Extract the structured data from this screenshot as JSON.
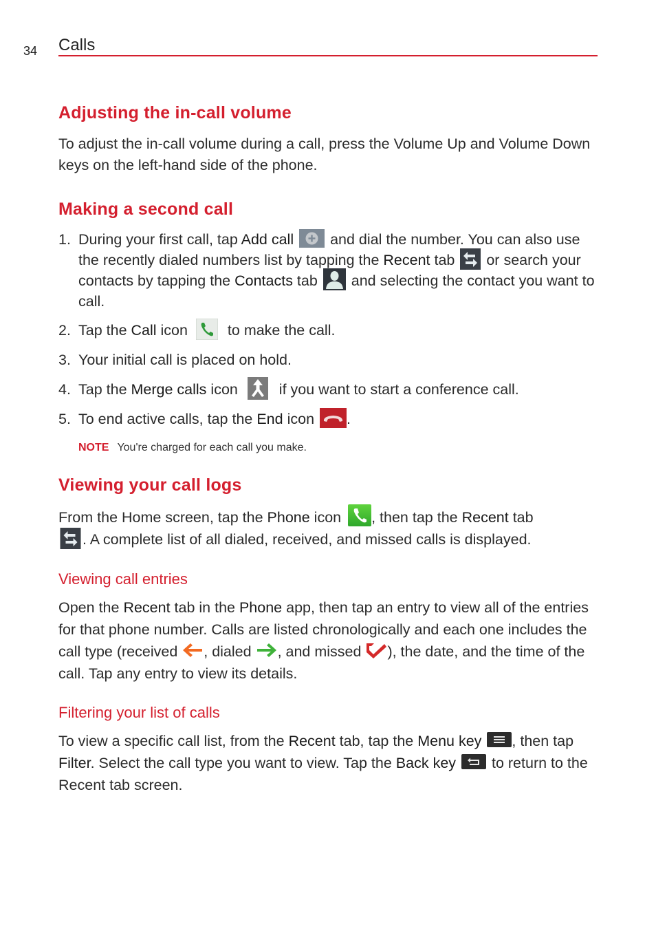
{
  "header": {
    "page_number": "34",
    "section": "Calls"
  },
  "colors": {
    "accent": "#d41f2e"
  },
  "sections": {
    "volume": {
      "title": "Adjusting the in-call volume",
      "body": "To adjust the in-call volume during a call, press the Volume Up and Volume Down keys on the left-hand side of the phone."
    },
    "second_call": {
      "title": "Making a second call",
      "steps": [
        {
          "num": "1.",
          "t1": "During your first call, tap ",
          "b1": "Add call",
          "t2": " and dial the number. You can also use the recently dialed numbers list by tapping the ",
          "b2": "Recent",
          "t3": " tab ",
          "t4": " or search your contacts by tapping the ",
          "b3": "Contacts",
          "t5": " tab ",
          "t6": " and selecting the contact you want to call."
        },
        {
          "num": "2.",
          "t1": "Tap the ",
          "b1": "Call",
          "t2": " icon ",
          "t3": " to make the call."
        },
        {
          "num": "3.",
          "t1": "Your initial call is placed on hold."
        },
        {
          "num": "4.",
          "t1": "Tap the ",
          "b1": "Merge calls",
          "t2": " icon ",
          "t3": " if you want to start a conference call."
        },
        {
          "num": "5.",
          "t1": "To end active calls, tap the ",
          "b1": "End",
          "t2": " icon ",
          "t3": "."
        }
      ],
      "note_label": "NOTE",
      "note_text": "You're charged for each call you make."
    },
    "call_logs": {
      "title": "Viewing your call logs",
      "t1": "From the Home screen, tap the ",
      "b1": "Phone",
      "t2": " icon ",
      "t3": ", then tap the ",
      "b2": "Recent",
      "t4": " tab",
      "t5": ". A complete list of all dialed, received, and missed calls is displayed."
    },
    "call_entries": {
      "title": "Viewing call entries",
      "t1": "Open the ",
      "b1": "Recent",
      "t2": " tab in the ",
      "b2": "Phone",
      "t3": " app, then tap an entry to view all of the entries for that phone number. Calls are listed chronologically and each one includes the call type (received ",
      "t4": ", dialed ",
      "t5": ", and missed ",
      "t6": "), the date, and the time of the call. Tap any entry to view its details."
    },
    "filtering": {
      "title": "Filtering your list of calls",
      "t1": "To view a specific call list, from the ",
      "b1": "Recent",
      "t2": " tab, tap the ",
      "b2": "Menu key",
      "t3": ", then tap ",
      "b3": "Filter",
      "t4": ". Select the call type you want to view. Tap the ",
      "b4": "Back key",
      "t5": " to return to the Recent tab screen."
    }
  },
  "icons": {
    "add_call": "add-call-icon",
    "recent_tab": "recent-tab-icon",
    "contacts_tab": "contacts-tab-icon",
    "call": "call-icon",
    "merge_calls": "merge-calls-icon",
    "end_call": "end-call-icon",
    "phone": "phone-icon",
    "received": "received-call-icon",
    "dialed": "dialed-call-icon",
    "missed": "missed-call-icon",
    "menu_key": "menu-key-icon",
    "back_key": "back-key-icon"
  }
}
